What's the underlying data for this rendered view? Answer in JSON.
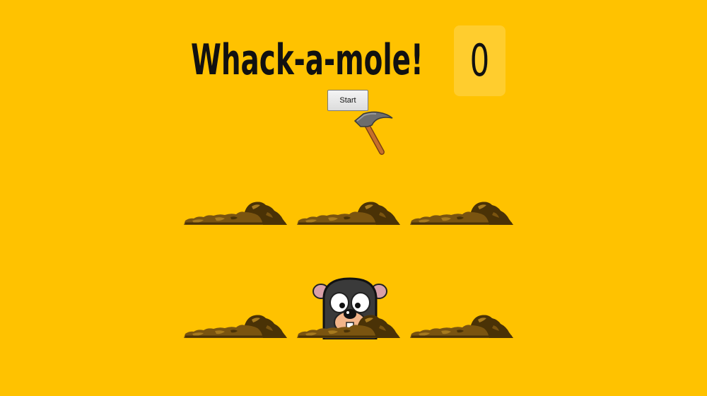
{
  "game": {
    "title": "Whack-a-mole!",
    "score": "0",
    "start_label": "Start"
  },
  "colors": {
    "background": "#FFC200",
    "dirt_dark": "#4A3206",
    "dirt_mid": "#7A5410",
    "dirt_light": "#A77A1E",
    "mole_body": "#3A3A3A",
    "mole_snout": "#F2B489"
  },
  "board": {
    "rows": 2,
    "cols": 3,
    "holes": [
      {
        "id": 1,
        "has_mole": false
      },
      {
        "id": 2,
        "has_mole": false
      },
      {
        "id": 3,
        "has_mole": false
      },
      {
        "id": 4,
        "has_mole": false
      },
      {
        "id": 5,
        "has_mole": true
      },
      {
        "id": 6,
        "has_mole": false
      }
    ]
  },
  "icons": {
    "cursor": "hammer-icon"
  }
}
